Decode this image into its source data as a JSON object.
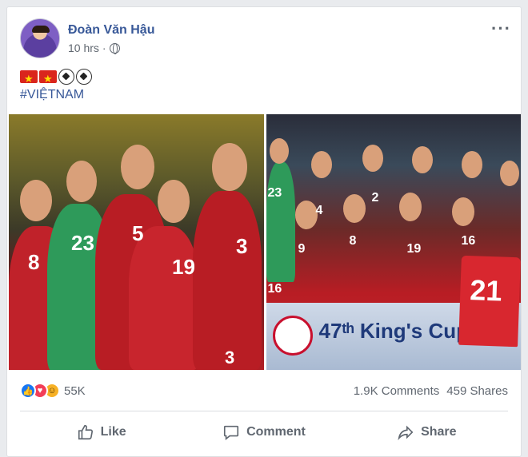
{
  "post": {
    "author": "Đoàn Văn Hậu",
    "timestamp": "10 hrs",
    "privacy_icon": "globe-icon",
    "hashtag": "#VIỆTNAM",
    "emojis": [
      "vietnam-flag",
      "vietnam-flag",
      "soccer-ball",
      "soccer-ball"
    ]
  },
  "photos": {
    "left": {
      "jersey_numbers": [
        "8",
        "23",
        "5",
        "19",
        "3",
        "3"
      ]
    },
    "right": {
      "jersey_numbers": [
        "23",
        "4",
        "2",
        "16",
        "9",
        "8",
        "19",
        "16",
        "21"
      ],
      "banner_text": "47ᵗʰ King's Cup"
    }
  },
  "engagement": {
    "reaction_icons": [
      "like-icon",
      "love-icon",
      "haha-icon"
    ],
    "reaction_count": "55K",
    "comments": "1.9K Comments",
    "shares": "459 Shares"
  },
  "actions": {
    "like": "Like",
    "comment": "Comment",
    "share": "Share"
  },
  "colors": {
    "link": "#385898",
    "meta": "#606770",
    "jersey_red": "#b01e24",
    "keeper_green": "#2e9a5a"
  }
}
